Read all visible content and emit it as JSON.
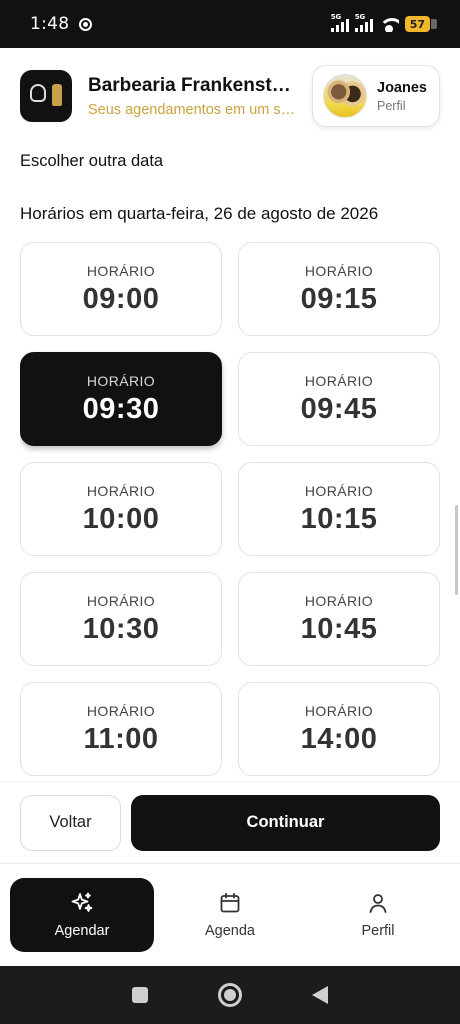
{
  "status_bar": {
    "time": "1:48",
    "network_1": "5G",
    "network_2": "5G",
    "battery": "57"
  },
  "header": {
    "shop_name": "Barbearia Frankenstein",
    "shop_subtitle": "Seus agendamentos em um só lugar",
    "profile_name": "Joanes",
    "profile_role": "Perfil"
  },
  "change_date_label": "Escolher outra data",
  "schedule_heading": "Horários em quarta-feira, 26 de agosto de 2026",
  "slot_label": "HORÁRIO",
  "slots": [
    {
      "time": "09:00",
      "selected": false
    },
    {
      "time": "09:15",
      "selected": false
    },
    {
      "time": "09:30",
      "selected": true
    },
    {
      "time": "09:45",
      "selected": false
    },
    {
      "time": "10:00",
      "selected": false
    },
    {
      "time": "10:15",
      "selected": false
    },
    {
      "time": "10:30",
      "selected": false
    },
    {
      "time": "10:45",
      "selected": false
    },
    {
      "time": "11:00",
      "selected": false
    },
    {
      "time": "14:00",
      "selected": false
    }
  ],
  "actions": {
    "back_label": "Voltar",
    "continue_label": "Continuar"
  },
  "nav": {
    "schedule_label": "Agendar",
    "agenda_label": "Agenda",
    "profile_label": "Perfil"
  },
  "icons": {
    "status": [
      "chrome-icon",
      "signal-icon",
      "wifi-icon",
      "battery-icon"
    ],
    "nav": [
      "sparkle-icon",
      "calendar-icon",
      "user-icon"
    ],
    "system": [
      "recents-icon",
      "home-icon",
      "back-icon"
    ]
  },
  "colors": {
    "accent_gold": "#c9a33e",
    "primary_dark": "#111111",
    "battery": "#f2b72a"
  }
}
